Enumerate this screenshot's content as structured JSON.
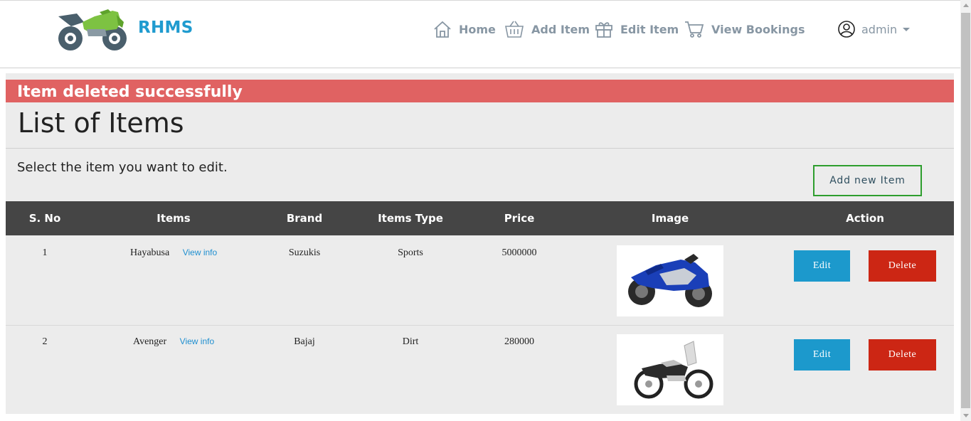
{
  "nav": {
    "brand": "RHMS",
    "logo_icon": "motorcycle-logo",
    "items": [
      {
        "label": "Home",
        "icon": "home-icon"
      },
      {
        "label": "Add Item",
        "icon": "basket-icon"
      },
      {
        "label": "Edit Item",
        "icon": "gift-icon"
      },
      {
        "label": "View Bookings",
        "icon": "cart-icon"
      }
    ],
    "user": {
      "label": "admin",
      "icon": "user-circle-icon"
    }
  },
  "alert": {
    "text": "Item deleted successfully",
    "color": "#e06262"
  },
  "page": {
    "title": "List of Items",
    "subtitle": "Select the item you want to edit.",
    "add_button": "Add new Item"
  },
  "table": {
    "headers": [
      "S. No",
      "Items",
      "Brand",
      "Items Type",
      "Price",
      "Image",
      "Action"
    ],
    "rows": [
      {
        "sno": "1",
        "item": "Hayabusa",
        "link": "View info",
        "brand": "Suzukis",
        "type": "Sports",
        "price": "5000000",
        "image": "blue-sport-motorcycle-image",
        "edit": "Edit",
        "delete": "Delete"
      },
      {
        "sno": "2",
        "item": "Avenger",
        "link": "View info",
        "brand": "Bajaj",
        "type": "Dirt",
        "price": "280000",
        "image": "cruiser-motorcycle-image",
        "edit": "Edit",
        "delete": "Delete"
      }
    ]
  },
  "colors": {
    "brand": "#1f9bcf",
    "header": "#454545",
    "edit": "#1c99cc",
    "delete": "#cc2614",
    "add_border": "#2e9e2e"
  }
}
